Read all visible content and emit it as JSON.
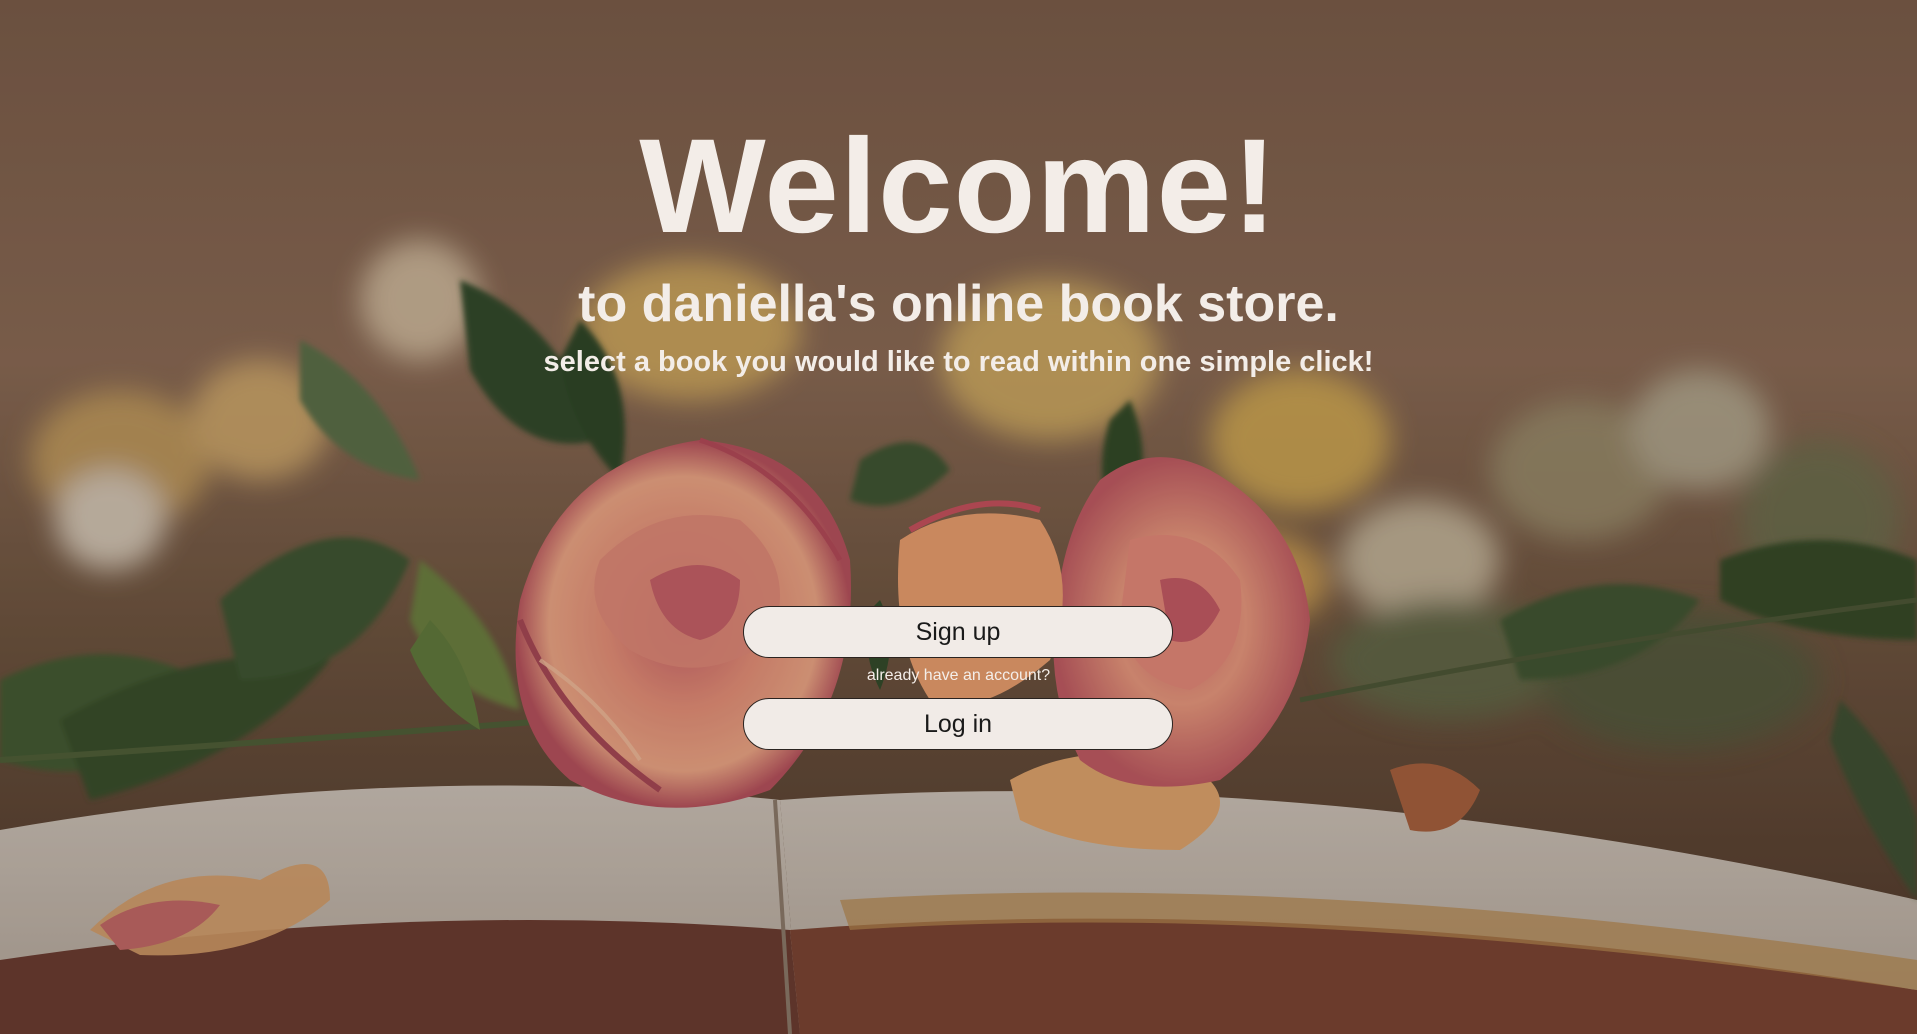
{
  "hero": {
    "title": "Welcome!",
    "subtitle": "to daniella's online book store.",
    "tagline": "select a book you would like to read within one simple click!"
  },
  "auth": {
    "signup_label": "Sign up",
    "account_hint": "already have an account?",
    "login_label": "Log in"
  },
  "background": {
    "description_icon": "roses-on-open-book-image"
  },
  "colors": {
    "text": "#f3ede8",
    "button_bg": "#f1ebe7",
    "button_border": "#2a2320"
  }
}
